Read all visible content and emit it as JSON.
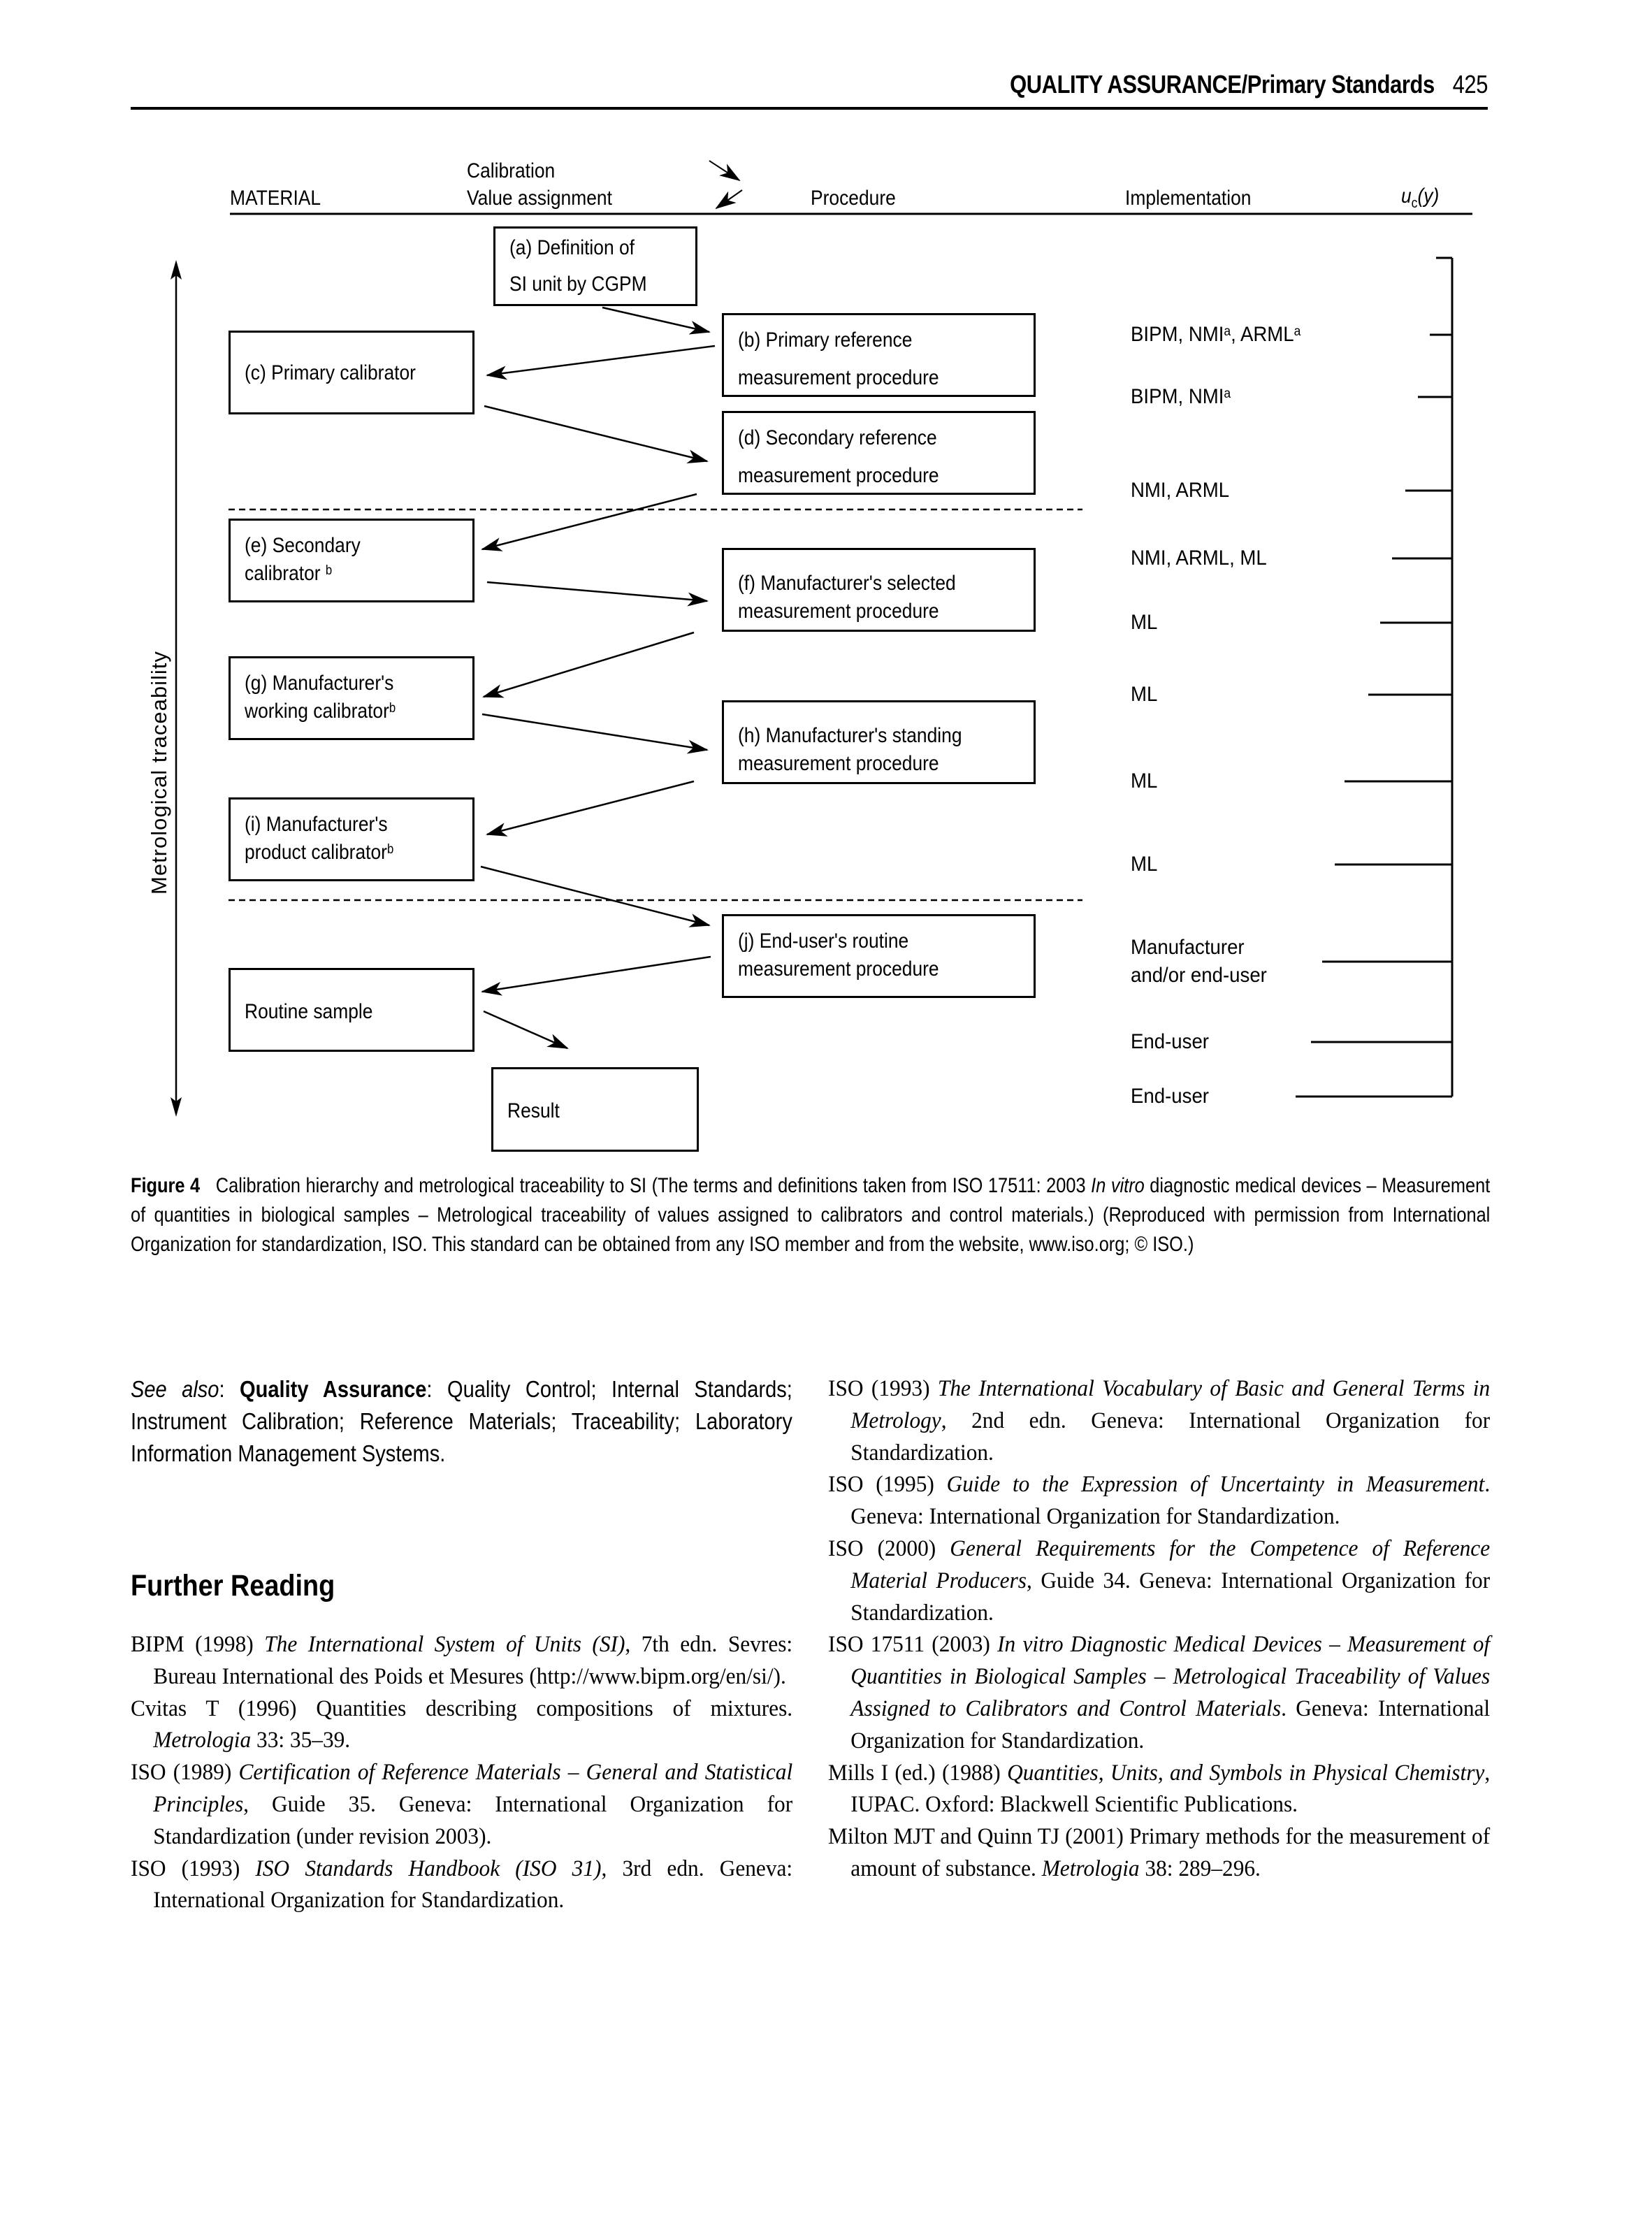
{
  "running_head": {
    "section": "QUALITY ASSURANCE",
    "separator": "/",
    "subsection": "Primary Standards",
    "page_number": "425"
  },
  "figure": {
    "column_headers": {
      "material": "MATERIAL",
      "calibration_line1": "Calibration",
      "calibration_line2": "Value assignment",
      "procedure": "Procedure",
      "implementation": "Implementation",
      "uncertainty_symbol": "u",
      "uncertainty_subscript": "c",
      "uncertainty_arg": "(y)"
    },
    "vertical_axis_label": "Metrological traceability",
    "boxes": {
      "a": [
        "(a) Definition of",
        "SI unit by CGPM"
      ],
      "b": [
        "(b) Primary reference",
        "measurement procedure"
      ],
      "c": [
        "(c) Primary calibrator"
      ],
      "d": [
        "(d) Secondary  reference",
        "measurement procedure"
      ],
      "e": [
        "(e) Secondary",
        "calibrator",
        "b"
      ],
      "f": [
        "(f) Manufacturer's  selected",
        "measurement procedure"
      ],
      "g": [
        "(g) Manufacturer's",
        "working calibrator",
        "b"
      ],
      "h": [
        "(h) Manufacturer's  standing",
        "measurement procedure"
      ],
      "i": [
        "(i) Manufacturer's",
        "product calibrator",
        "b"
      ],
      "j": [
        "(j) End-user's routine",
        "measurement procedure"
      ],
      "routine": [
        "Routine sample"
      ],
      "result": [
        "Result"
      ]
    },
    "implementation": [
      {
        "text": "BIPM, NMI",
        "sup": "a",
        "text2": ", ARML",
        "sup2": "a"
      },
      {
        "text": "BIPM, NMI",
        "sup": "a"
      },
      {
        "text": "NMI, ARML"
      },
      {
        "text": "NMI, ARML, ML"
      },
      {
        "text": "ML"
      },
      {
        "text": "ML"
      },
      {
        "text": "ML"
      },
      {
        "text": "ML"
      },
      {
        "text": "Manufacturer",
        "line2": "and/or end-user"
      },
      {
        "text": "End-user"
      },
      {
        "text": "End-user"
      }
    ]
  },
  "caption": {
    "label": "Figure 4",
    "text1": "Calibration hierarchy and metrological traceability to SI (The terms and definitions taken from ISO 17511: 2003 ",
    "italic": "In vitro",
    "text2": " diagnostic medical devices – Measurement of quantities in biological samples – Metrological traceability of values assigned to calibrators and control materials.) (Reproduced with permission from International Organization for standardization, ISO. This standard can be obtained from any ISO member and from the website, www.iso.org; © ISO.)"
  },
  "see_also": {
    "prefix": "See also",
    "colon": ": ",
    "bold": "Quality Assurance",
    "rest": ": Quality Control; Internal Standards; Instrument Calibration; Reference Materials; Traceability; Laboratory Information Management Systems."
  },
  "further_reading": {
    "heading": "Further Reading",
    "left_refs": [
      {
        "pre": "BIPM (1998) ",
        "title": "The International System of Units (SI)",
        "post": ", 7th edn. Sevres: Bureau International des Poids et Mesures (http://www.bipm.org/en/si/)."
      },
      {
        "pre": "Cvitas T (1996) Quantities describing compositions of mixtures. ",
        "title": "Metrologia",
        "post": " 33: 35–39."
      },
      {
        "pre": "ISO (1989) ",
        "title": "Certification of Reference Materials – General and Statistical Principles",
        "post": ", Guide 35. Geneva: International Organization for Standardization (under revision 2003)."
      },
      {
        "pre": "ISO (1993) ",
        "title": "ISO Standards Handbook (ISO 31)",
        "post": ", 3rd edn. Geneva: International Organization for Standardization."
      }
    ],
    "right_refs": [
      {
        "pre": "ISO (1993) ",
        "title": "The International Vocabulary of Basic and General Terms in Metrology",
        "post": ", 2nd edn. Geneva: International Organization for Standardization."
      },
      {
        "pre": "ISO (1995) ",
        "title": "Guide to the Expression of Uncertainty in Measurement",
        "post": ". Geneva: International Organization for Standardization."
      },
      {
        "pre": "ISO (2000) ",
        "title": "General Requirements for the Competence of Reference Material Producers",
        "post": ", Guide 34. Geneva: International Organization for Standardization."
      },
      {
        "pre": "ISO 17511 (2003) ",
        "title": "In vitro Diagnostic Medical Devices – Measurement of Quantities in Biological Samples – Metrological Traceability of Values Assigned to Calibrators and Control Materials",
        "post": ". Geneva: International Organization for Standardization."
      },
      {
        "pre": "Mills I (ed.) (1988) ",
        "title": "Quantities, Units, and Symbols in Physical Chemistry",
        "post": ", IUPAC. Oxford: Blackwell Scientific Publications."
      },
      {
        "pre": "Milton MJT and Quinn TJ (2001) Primary methods for the measurement of amount of substance. ",
        "title": "Metrologia",
        "post": " 38: 289–296."
      }
    ]
  }
}
